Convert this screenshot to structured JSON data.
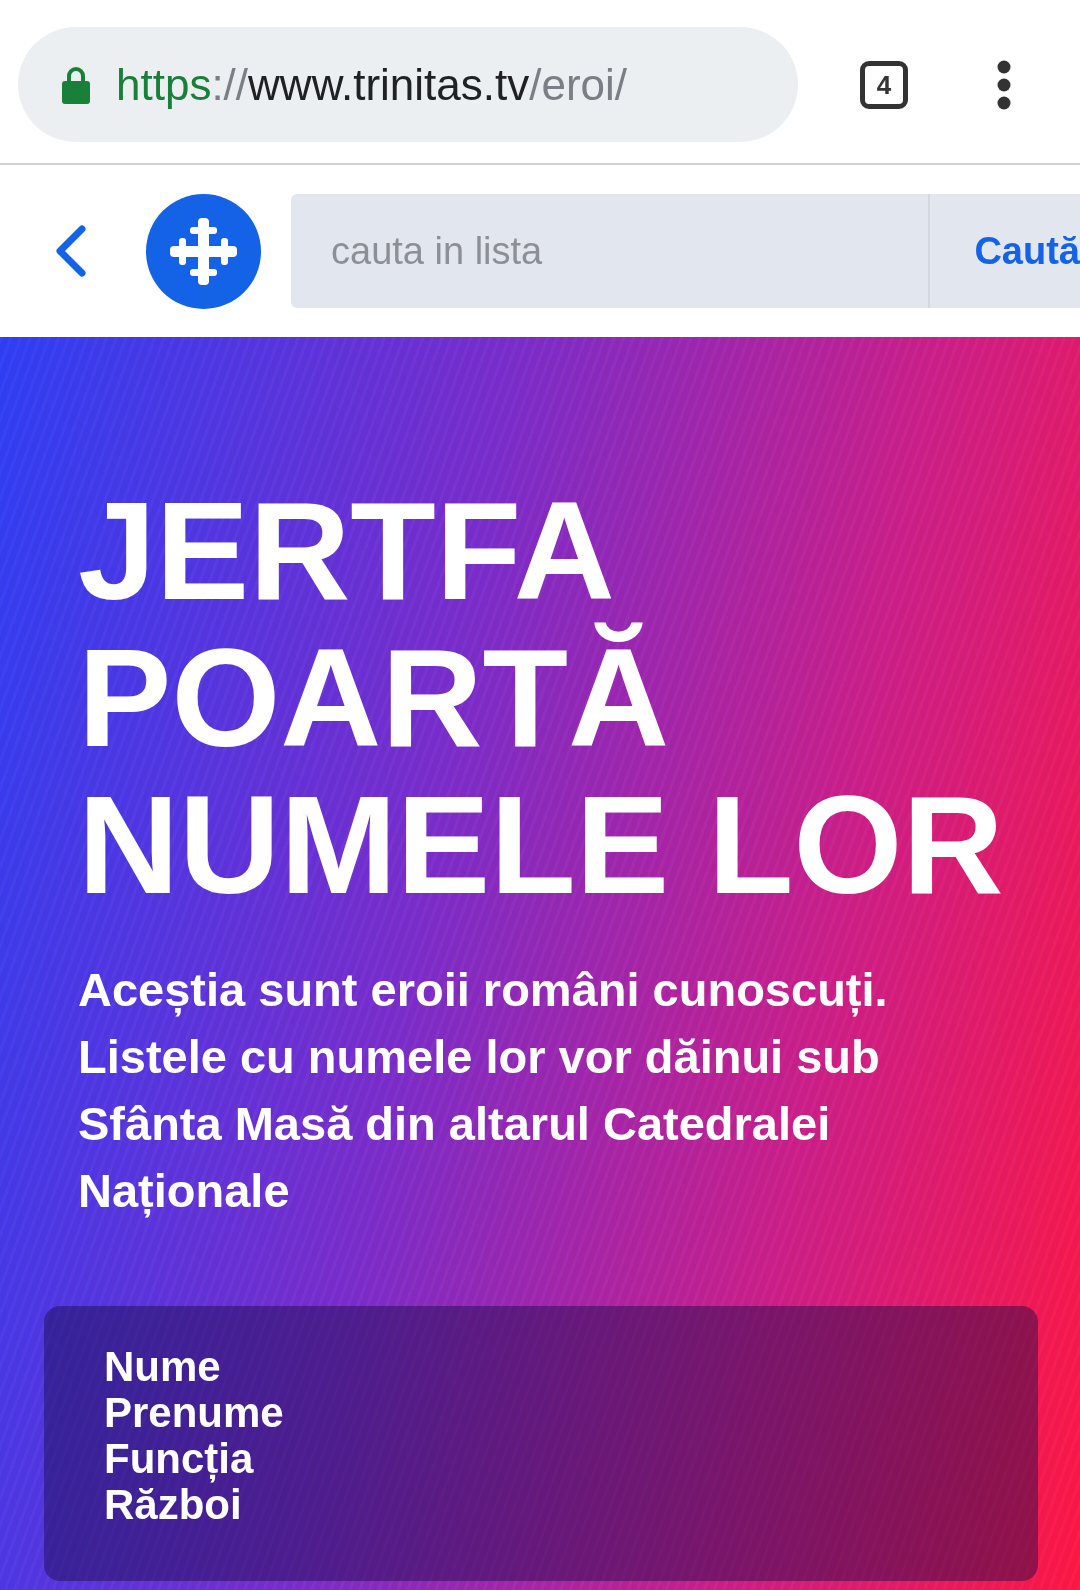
{
  "browser": {
    "url": {
      "scheme": "https",
      "separator": "://",
      "host": "www.trinitas.tv",
      "path": "/eroi/"
    },
    "tab_count": "4"
  },
  "header": {
    "search": {
      "placeholder": "cauta in lista"
    },
    "search_button": "Caută"
  },
  "hero": {
    "title": "JERTFA POARTĂ NUMELE LOR",
    "subtitle": "Aceștia sunt eroii români cunoscuți. Listele cu numele lor vor dăinui sub Sfânta Masă din altarul Catedralei Naționale"
  },
  "list_header": {
    "columns": [
      "Nume",
      "Prenume",
      "Funcția",
      "Război"
    ]
  }
}
